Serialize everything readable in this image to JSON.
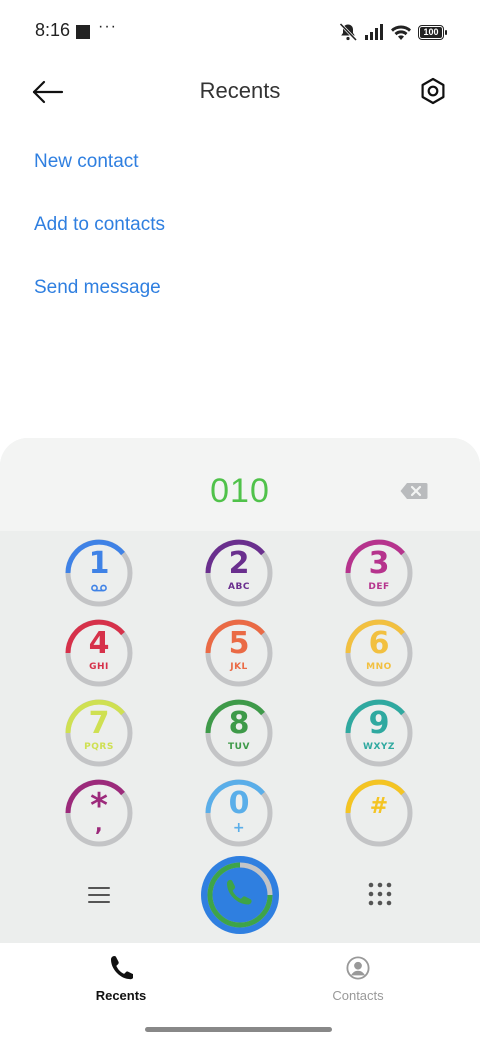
{
  "status_bar": {
    "time": "8:16",
    "more": "···",
    "battery": "100"
  },
  "header": {
    "title": "Recents",
    "back_icon": "arrow-left-icon",
    "settings_icon": "hexagon-settings-icon"
  },
  "actions": [
    "New contact",
    "Add to contacts",
    "Send message"
  ],
  "dialer": {
    "number": "010",
    "delete_icon": "backspace-icon",
    "keys": [
      {
        "digit": "1",
        "letters": "",
        "color": "#3f82e6",
        "voicemail": true
      },
      {
        "digit": "2",
        "letters": "ABC",
        "color": "#6a2f8e"
      },
      {
        "digit": "3",
        "letters": "DEF",
        "color": "#b6338d"
      },
      {
        "digit": "4",
        "letters": "GHI",
        "color": "#d6314a"
      },
      {
        "digit": "5",
        "letters": "JKL",
        "color": "#ea6a45"
      },
      {
        "digit": "6",
        "letters": "MNO",
        "color": "#f2c040"
      },
      {
        "digit": "7",
        "letters": "PQRS",
        "color": "#cfe052"
      },
      {
        "digit": "8",
        "letters": "TUV",
        "color": "#3e9a49"
      },
      {
        "digit": "9",
        "letters": "WXYZ",
        "color": "#2fa9a0"
      },
      {
        "digit": "*",
        "letters": ",",
        "color": "#9c2a7b"
      },
      {
        "digit": "0",
        "letters": "+",
        "color": "#5aaee9"
      },
      {
        "digit": "#",
        "letters": "",
        "color": "#f4c423"
      }
    ],
    "menu_icon": "hamburger-menu-icon",
    "call_icon": "phone-icon",
    "keypad_icon": "keypad-grid-icon",
    "ring_gray": "#c3c4c6",
    "call_blue": "#2f7fe0",
    "call_green": "#3ea448"
  },
  "bottom_nav": {
    "recents": "Recents",
    "contacts": "Contacts"
  }
}
